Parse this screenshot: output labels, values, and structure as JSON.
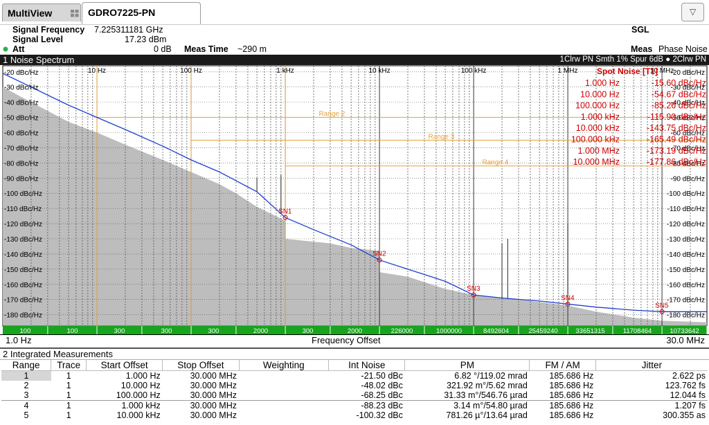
{
  "tabs": {
    "multiview": "MultiView",
    "active": "GDRO7225-PN",
    "dropdown": "▽"
  },
  "info": {
    "signal_frequency_label": "Signal Frequency",
    "signal_frequency_value": "7.225311181 GHz",
    "signal_level_label": "Signal Level",
    "signal_level_value": "17.23 dBm",
    "att_label": "Att",
    "att_value": "0 dB",
    "meas_time_label": "Meas Time",
    "meas_time_value": "~290 m",
    "sgl": "SGL",
    "meas_label": "Meas",
    "meas_value": "Phase Noise"
  },
  "panel": {
    "title": "1 Noise Spectrum",
    "trace_info": "1Clrw PN Smth 1% Spur 6dB ● 2Clrw PN"
  },
  "colors": {
    "trace1": "#1f3fd0",
    "trace2": "#bdbdbd",
    "range": "#e6a23c",
    "spot": "#cc0000",
    "marker": "#cc0000",
    "green_bar": "#17a51d"
  },
  "chart_data": {
    "type": "line",
    "xscale": "log",
    "xlabel": "Frequency Offset",
    "xlim_labels": [
      "1.0 Hz",
      "30.0 MHz"
    ],
    "xlim": [
      1,
      30000000
    ],
    "ylim": [
      -187,
      -16
    ],
    "x_ticks": [
      {
        "v": 10,
        "t": "10 Hz"
      },
      {
        "v": 100,
        "t": "100 Hz"
      },
      {
        "v": 1000,
        "t": "1 kHz"
      },
      {
        "v": 10000,
        "t": "10 kHz"
      },
      {
        "v": 100000,
        "t": "100 kHz"
      },
      {
        "v": 1000000,
        "t": "1 MHz"
      },
      {
        "v": 10000000,
        "t": "10 MHz"
      }
    ],
    "y_ticks": [
      {
        "v": -20,
        "l": "-20 dBc/Hz",
        "r": "-20 dBc/Hz"
      },
      {
        "v": -30,
        "l": "-30 dBc/Hz",
        "r": "-30 dBc/Hz"
      },
      {
        "v": -40,
        "l": "-40 dBc/Hz",
        "r": "-40 dBc/Hz"
      },
      {
        "v": -50,
        "l": "-50 dBc/Hz",
        "r": "-50 dBc/Hz"
      },
      {
        "v": -60,
        "l": "-60 dBc/Hz",
        "r": "-60 dBc/Hz"
      },
      {
        "v": -70,
        "l": "-70 dBc/Hz",
        "r": "-70 dBc/Hz"
      },
      {
        "v": -80,
        "l": "-80 dBc/Hz",
        "r": "-80 dBc/Hz"
      },
      {
        "v": -90,
        "l": "-90 dBc/Hz",
        "r": "-90 dBc/Hz"
      },
      {
        "v": -100,
        "l": "-100 dBc/Hz",
        "r": "-100 dBc/Hz"
      },
      {
        "v": -110,
        "l": "-110 dBc/Hz",
        "r": "-110 dBc/Hz"
      },
      {
        "v": -120,
        "l": "-120 dBc/Hz",
        "r": "-120 dBc/Hz"
      },
      {
        "v": -130,
        "l": "-130 dBc/Hz",
        "r": "-130 dBc/Hz"
      },
      {
        "v": -140,
        "l": "-140 dBc/Hz",
        "r": "-140 dBc/Hz"
      },
      {
        "v": -150,
        "l": "-150 dBc/Hz",
        "r": "-150 dBc/Hz"
      },
      {
        "v": -160,
        "l": "-160 dBc/Hz",
        "r": "-160 dBc/Hz"
      },
      {
        "v": -170,
        "l": "-170 dBc/Hz",
        "r": "-170 dBc/Hz"
      },
      {
        "v": -180,
        "l": "-180 dBc/Hz",
        "r": "-180 dBc/Hz"
      }
    ],
    "series": [
      {
        "points": [
          [
            1,
            -21
          ],
          [
            2,
            -30
          ],
          [
            5,
            -42
          ],
          [
            10,
            -50
          ],
          [
            20,
            -58
          ],
          [
            50,
            -69
          ],
          [
            100,
            -78
          ],
          [
            200,
            -86
          ],
          [
            500,
            -99
          ],
          [
            1000,
            -116
          ],
          [
            2000,
            -124
          ],
          [
            5000,
            -134
          ],
          [
            10000,
            -144
          ],
          [
            20000,
            -150
          ],
          [
            50000,
            -158
          ],
          [
            100000,
            -167
          ],
          [
            200000,
            -169
          ],
          [
            500000,
            -171
          ],
          [
            1000000,
            -173
          ],
          [
            2000000,
            -175
          ],
          [
            5000000,
            -177
          ],
          [
            10000000,
            -178
          ],
          [
            30000000,
            -178
          ]
        ],
        "spurs": [
          [
            500,
            -90
          ],
          [
            900,
            -88
          ],
          [
            200000,
            -133
          ],
          [
            230000,
            -130
          ],
          [
            1000000,
            -120
          ]
        ]
      },
      {
        "points": [
          [
            1,
            -30
          ],
          [
            2,
            -40
          ],
          [
            5,
            -53
          ],
          [
            10,
            -60
          ],
          [
            20,
            -68
          ],
          [
            50,
            -78
          ],
          [
            100,
            -86
          ],
          [
            200,
            -94
          ],
          [
            300,
            -100
          ],
          [
            500,
            -109
          ],
          [
            1000,
            -118
          ],
          [
            1001,
            -130
          ],
          [
            3000,
            -133
          ],
          [
            5000,
            -136
          ],
          [
            10000,
            -138
          ],
          [
            10001,
            -152
          ],
          [
            20000,
            -155
          ],
          [
            50000,
            -163
          ],
          [
            100000,
            -167
          ],
          [
            300000,
            -170
          ],
          [
            1000000,
            -174
          ],
          [
            2000000,
            -178
          ],
          [
            5000000,
            -182
          ],
          [
            10000000,
            -184
          ],
          [
            30000000,
            -185
          ]
        ]
      }
    ],
    "ranges": [
      {
        "label": "Range 2",
        "x": [
          10,
          30000000
        ],
        "y": -50
      },
      {
        "label": "Range 3",
        "x": [
          100,
          30000000
        ],
        "y": -65
      },
      {
        "label": "Range 4",
        "x": [
          1000,
          30000000
        ],
        "y": -82
      }
    ],
    "markers": [
      {
        "label": "SN1",
        "x": 1000,
        "y": -116
      },
      {
        "label": "SN2",
        "x": 10000,
        "y": -144
      },
      {
        "label": "SN3",
        "x": 100000,
        "y": -167
      },
      {
        "label": "SN4",
        "x": 1000000,
        "y": -173
      },
      {
        "label": "SN5",
        "x": 10000000,
        "y": -178
      }
    ],
    "spot_noise": {
      "title": "Spot Noise [T1]",
      "rows": [
        {
          "freq": "1.000 Hz",
          "value": "-15.60 dBc/Hz"
        },
        {
          "freq": "10.000 Hz",
          "value": "-54.67 dBc/Hz"
        },
        {
          "freq": "100.000 Hz",
          "value": "-85.26 dBc/Hz"
        },
        {
          "freq": "1.000 kHz",
          "value": "-115.90 dBc/Hz"
        },
        {
          "freq": "10.000 kHz",
          "value": "-143.75 dBc/Hz"
        },
        {
          "freq": "100.000 kHz",
          "value": "-165.49 dBc/Hz"
        },
        {
          "freq": "1.000 MHz",
          "value": "-173.19 dBc/Hz"
        },
        {
          "freq": "10.000 MHz",
          "value": "-177.86 dBc/Hz"
        }
      ]
    },
    "bins": [
      {
        "x0": 1,
        "x1": 3,
        "n": "100"
      },
      {
        "x0": 3,
        "x1": 10,
        "n": "100"
      },
      {
        "x0": 10,
        "x1": 30,
        "n": "300"
      },
      {
        "x0": 30,
        "x1": 100,
        "n": "300"
      },
      {
        "x0": 100,
        "x1": 300,
        "n": "300"
      },
      {
        "x0": 300,
        "x1": 1000,
        "n": "2000"
      },
      {
        "x0": 1000,
        "x1": 3000,
        "n": "300"
      },
      {
        "x0": 3000,
        "x1": 10000,
        "n": "2000"
      },
      {
        "x0": 10000,
        "x1": 30000,
        "n": "226000"
      },
      {
        "x0": 30000,
        "x1": 100000,
        "n": "1000000"
      },
      {
        "x0": 100000,
        "x1": 300000,
        "n": "8492604"
      },
      {
        "x0": 300000,
        "x1": 1000000,
        "n": "25459240"
      },
      {
        "x0": 1000000,
        "x1": 3000000,
        "n": "33651315"
      },
      {
        "x0": 3000000,
        "x1": 10000000,
        "n": "11708464"
      },
      {
        "x0": 10000000,
        "x1": 30000000,
        "n": "10733642"
      }
    ]
  },
  "meas": {
    "title": "2 Integrated Measurements",
    "headers": [
      "Range",
      "Trace",
      "Start Offset",
      "Stop Offset",
      "Weighting",
      "Int Noise",
      "PM",
      "FM / AM",
      "Jitter"
    ],
    "rows": [
      [
        "1",
        "1",
        "1.000 Hz",
        "30.000 MHz",
        "",
        "-21.50 dBc",
        "6.82 °/119.02 mrad",
        "185.686 Hz",
        "2.622 ps"
      ],
      [
        "2",
        "1",
        "10.000 Hz",
        "30.000 MHz",
        "",
        "-48.02 dBc",
        "321.92 m°/5.62 mrad",
        "185.686 Hz",
        "123.762 fs"
      ],
      [
        "3",
        "1",
        "100.000 Hz",
        "30.000 MHz",
        "",
        "-68.25 dBc",
        "31.33 m°/546.76 µrad",
        "185.686 Hz",
        "12.044 fs"
      ],
      [
        "4",
        "1",
        "1.000 kHz",
        "30.000 MHz",
        "",
        "-88.23 dBc",
        "3.14 m°/54.80 µrad",
        "185.686 Hz",
        "1.207 fs"
      ],
      [
        "5",
        "1",
        "10.000 kHz",
        "30.000 MHz",
        "",
        "-100.32 dBc",
        "781.26 µ°/13.64 µrad",
        "185.686 Hz",
        "300.355 as"
      ]
    ]
  }
}
